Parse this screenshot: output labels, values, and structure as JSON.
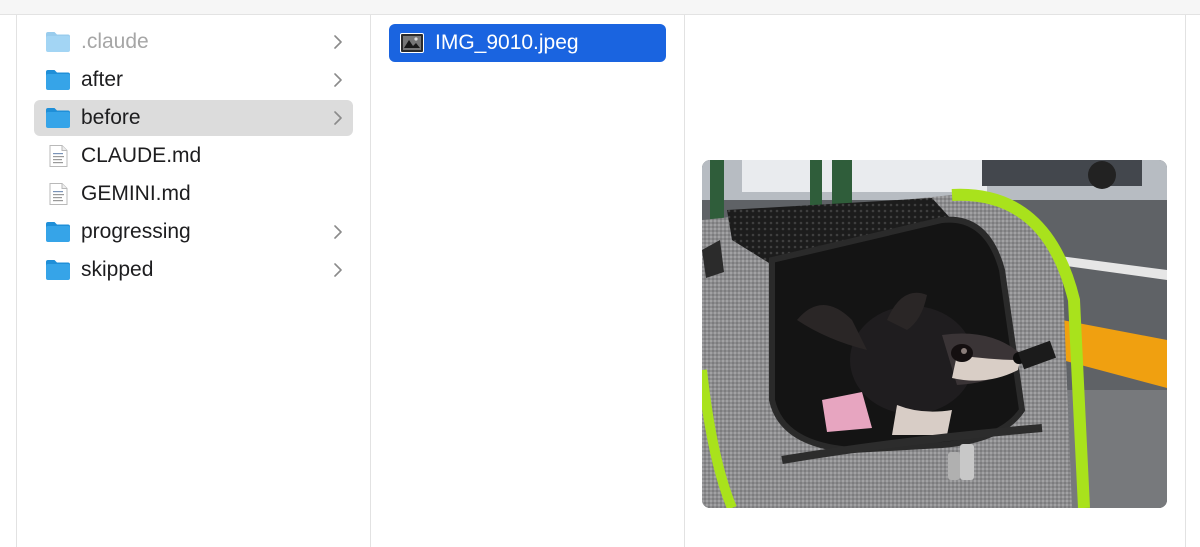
{
  "sidebar": {
    "items": [
      {
        "label": ".claude",
        "kind": "folder",
        "icon": "folder-icon",
        "has_children": true,
        "dimmed": true
      },
      {
        "label": "after",
        "kind": "folder",
        "icon": "folder-icon",
        "has_children": true
      },
      {
        "label": "before",
        "kind": "folder",
        "icon": "folder-icon",
        "has_children": true,
        "selected": true
      },
      {
        "label": "CLAUDE.md",
        "kind": "file",
        "icon": "document-icon",
        "has_children": false
      },
      {
        "label": "GEMINI.md",
        "kind": "file",
        "icon": "document-icon",
        "has_children": false
      },
      {
        "label": "progressing",
        "kind": "folder",
        "icon": "folder-icon",
        "has_children": true
      },
      {
        "label": "skipped",
        "kind": "folder",
        "icon": "folder-icon",
        "has_children": true
      }
    ]
  },
  "files": {
    "items": [
      {
        "label": "IMG_9010.jpeg",
        "icon": "image-thumbnail-icon",
        "selected": true
      }
    ]
  },
  "preview": {
    "subject": "chihuahua in pet carrier",
    "icon": "photo-preview"
  },
  "colors": {
    "selection_blue": "#1a64e0",
    "selection_gray": "#dcdcdc",
    "folder_blue": "#36a4e8"
  }
}
